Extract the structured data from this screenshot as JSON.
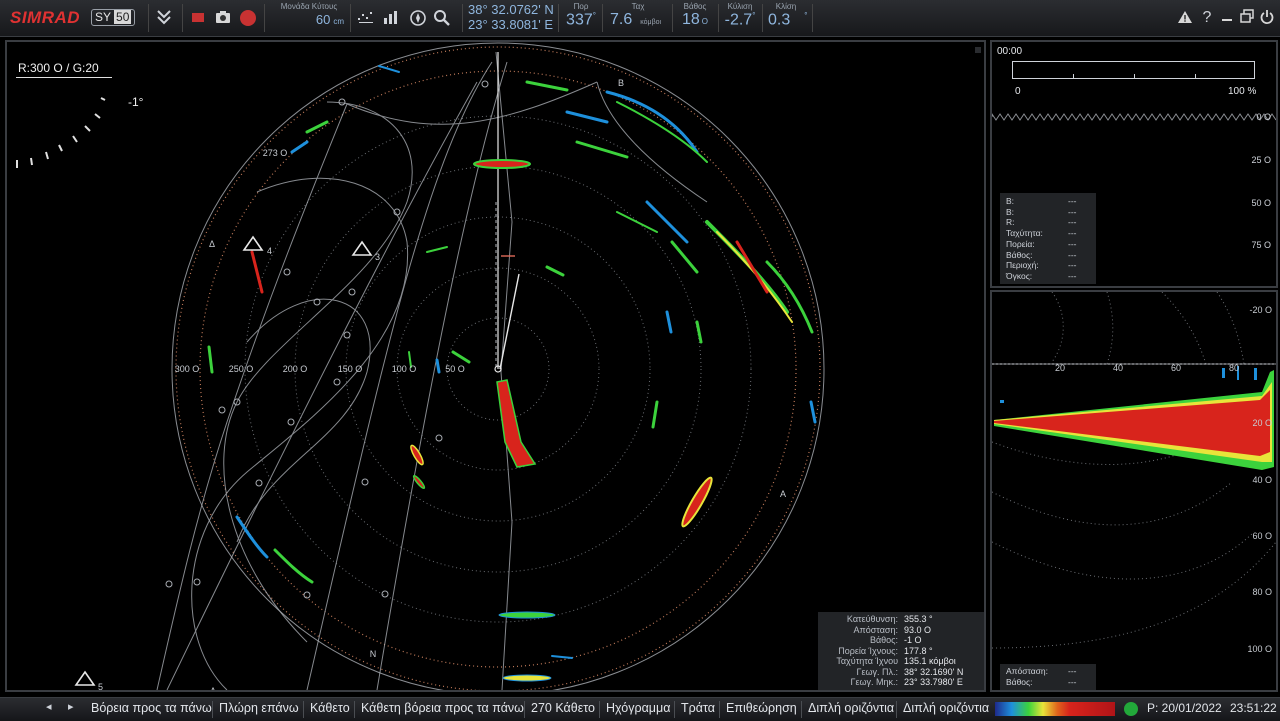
{
  "topbar": {
    "logo": "SIMRAD",
    "model": "SY",
    "model_num": "50",
    "unit_label": "Μονάδα Κύτους",
    "unit_value": "60",
    "unit_suffix": "cm",
    "lat": "38° 32.0762' N",
    "lon": "23° 33.8081' E",
    "course_label": "Πορ",
    "course_value": "337",
    "speed_label": "Ταχ",
    "speed_value": "7.6",
    "speed_unit": "κόμβοι",
    "depth_label": "Βάθος",
    "depth_value": "18",
    "depth_unit": "O",
    "roll_label": "Κύλιση",
    "roll_value": "-2.7",
    "tilt_label": "Κλίση",
    "tilt_value": "0.3"
  },
  "sonar": {
    "range_gain": "R:300 O / G:20",
    "tilt_angle": "-1°",
    "ring_labels": [
      "300 O",
      "250 O",
      "200 O",
      "150 O",
      "100 O",
      "50 O"
    ],
    "top_label": "273 O",
    "marker_b": "B",
    "marker_a": "A",
    "marker_n": "N",
    "marker_delta": "Δ",
    "targets": [
      "4",
      "3",
      "5"
    ]
  },
  "info_box": {
    "rows": [
      {
        "label": "Κατεύθυνση:",
        "value": "355.3 °"
      },
      {
        "label": "Απόσταση:",
        "value": "93.0 O"
      },
      {
        "label": "Βάθος:",
        "value": "-1 O"
      },
      {
        "label": "Πορεία Ίχνους:",
        "value": "177.8 °"
      },
      {
        "label": "Ταχύτητα Ίχνου",
        "value": "135.1 κόμβοι"
      },
      {
        "label": "Γεωγ. Πλ.:",
        "value": "38° 32.1690' N"
      },
      {
        "label": "Γεωγ. Μηκ.:",
        "value": "23° 33.7980' E"
      }
    ]
  },
  "echo_panel": {
    "time": "00:00",
    "progress_min": "0",
    "progress_max": "100 %",
    "progress_fraction": 0.0,
    "depth_ticks": [
      "0 O",
      "25 O",
      "50 O",
      "75 O"
    ],
    "data_rows": [
      {
        "label": "B:",
        "value": "---"
      },
      {
        "label": "B:",
        "value": "---"
      },
      {
        "label": "R:",
        "value": "---"
      },
      {
        "label": "Ταχύτητα:",
        "value": "---"
      },
      {
        "label": "Πορεία:",
        "value": "---"
      },
      {
        "label": "Βάθος:",
        "value": "---"
      },
      {
        "label": "Περιοχή:",
        "value": "---"
      },
      {
        "label": "Όγκος:",
        "value": "---"
      }
    ]
  },
  "vertical_panel": {
    "left_ticks": [
      "-20 O",
      "20 O",
      "40 O",
      "60 O",
      "80 O",
      "100 O"
    ],
    "top_ticks": [
      "20",
      "40",
      "60",
      "80"
    ],
    "bottom_rows": [
      {
        "label": "Απόσταση:",
        "value": "---"
      },
      {
        "label": "Βάθος:",
        "value": "---"
      }
    ]
  },
  "bottombar": {
    "buttons": [
      "Βόρεια προς τα πάνω",
      "Πλώρη επάνω",
      "Κάθετο",
      "Κάθετη βόρεια προς τα πάνω",
      "270 Κάθετο",
      "Ηχόγραμμα",
      "Τράτα",
      "Επιθεώρηση",
      "Διπλή οριζόντια",
      "Διπλή οριζόντια"
    ],
    "date": "P: 20/01/2022",
    "time": "23:51:22"
  },
  "colors": {
    "accent": "#8fb6de",
    "brand": "#e03232",
    "echo_red": "#d8241c",
    "echo_green": "#3cd23c",
    "echo_yellow": "#e8e43a"
  }
}
